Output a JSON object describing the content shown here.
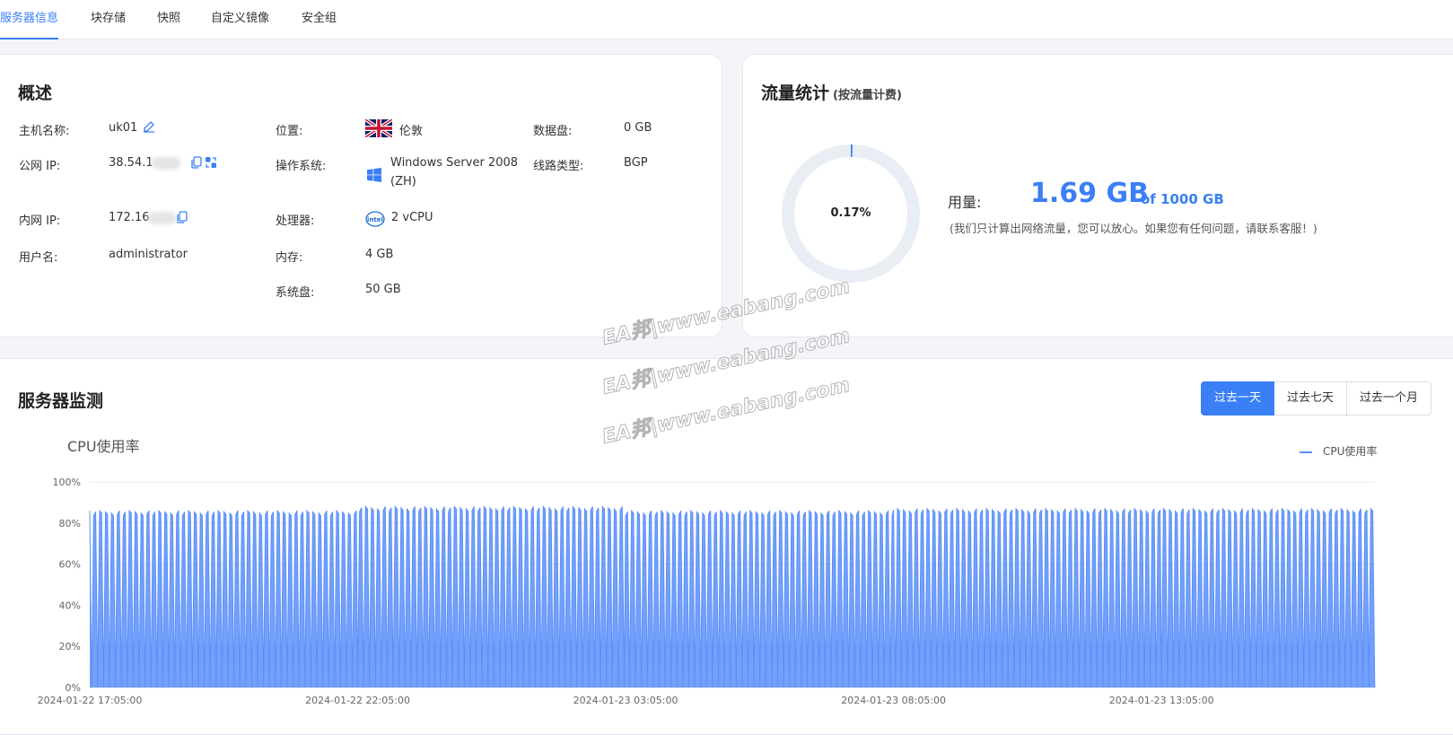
{
  "tabs": [
    "服务器信息",
    "块存储",
    "快照",
    "自定义镜像",
    "安全组"
  ],
  "overview": {
    "title": "概述",
    "hostname_label": "主机名称:",
    "hostname": "uk01",
    "public_ip_label": "公网 IP:",
    "public_ip": "38.54.1",
    "private_ip_label": "内网 IP:",
    "private_ip": "172.16",
    "username_label": "用户名:",
    "username": "administrator",
    "location_label": "位置:",
    "location": "伦敦",
    "os_label": "操作系统:",
    "os": "Windows Server 2008 (ZH)",
    "cpu_label": "处理器:",
    "cpu": "2 vCPU",
    "memory_label": "内存:",
    "memory": "4 GB",
    "system_disk_label": "系统盘:",
    "system_disk": "50 GB",
    "data_disk_label": "数据盘:",
    "data_disk": "0 GB",
    "line_type_label": "线路类型:",
    "line_type": "BGP"
  },
  "traffic": {
    "title": "流量统计",
    "subtitle": "(按流量计费)",
    "percent": "0.17%",
    "usage_label": "用量:",
    "usage_value": "1.69 GB",
    "usage_total": "of 1000 GB",
    "usage_fraction": 0.0017,
    "note": "(我们只计算出网络流量，您可以放心。如果您有任何问题，请联系客服！)"
  },
  "monitor": {
    "title": "服务器监测",
    "range_buttons": [
      "过去一天",
      "过去七天",
      "过去一个月"
    ],
    "active_range": 0
  },
  "watermark": "EA邦|www.eabang.com",
  "colors": {
    "accent": "#3a7ff5",
    "series": "#5b8ff9"
  },
  "chart_data": {
    "type": "line",
    "title": "CPU使用率",
    "legend": [
      "CPU使用率"
    ],
    "legend_position": "top-right",
    "ylim": [
      0,
      100
    ],
    "y_ticks": [
      "0%",
      "20%",
      "40%",
      "60%",
      "80%",
      "100%"
    ],
    "x_tick_labels": [
      "2024-01-22 17:05:00",
      "2024-01-22 22:05:00",
      "2024-01-23 03:05:00",
      "2024-01-23 08:05:00",
      "2024-01-23 13:05:00"
    ],
    "grid": true,
    "series": [
      {
        "name": "CPU使用率",
        "segments": [
          {
            "from": "2024-01-22 17:05:00",
            "to": "2024-01-22 22:05:00",
            "high": 86
          },
          {
            "from": "2024-01-22 22:05:00",
            "to": "2024-01-23 03:05:00",
            "high": 88
          },
          {
            "from": "2024-01-23 03:05:00",
            "to": "2024-01-23 08:05:00",
            "high": 86
          },
          {
            "from": "2024-01-23 08:05:00",
            "to": "2024-01-23 13:05:00",
            "high": 87
          },
          {
            "from": "2024-01-23 13:05:00",
            "to": "2024-01-23 17:05:00",
            "high": 87
          }
        ],
        "low": 0
      }
    ]
  }
}
